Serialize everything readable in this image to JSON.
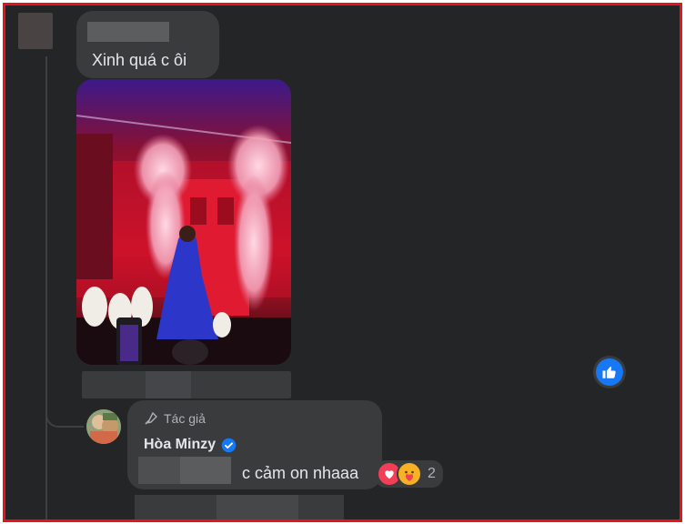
{
  "comment": {
    "text": "Xinh quá c ôi"
  },
  "reply": {
    "author_badge": "Tác giả",
    "author_name": "Hòa Minzy",
    "text": "c cảm on nhaaa",
    "reaction_count": "2",
    "reactions": [
      "heart-icon",
      "care-icon"
    ]
  },
  "icons": {
    "like": "thumbs-up-icon",
    "author": "microphone-icon",
    "verified": "verified-badge-icon"
  },
  "colors": {
    "background": "#242526",
    "bubble": "#3a3b3c",
    "accent": "#1877f2",
    "frame": "#e8121c"
  }
}
